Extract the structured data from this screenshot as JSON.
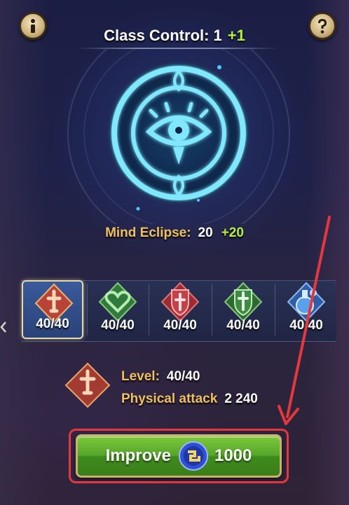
{
  "header": {
    "title_text": "Class Control: 1",
    "title_plus": "+1"
  },
  "buttons": {
    "info_icon": "info-icon",
    "help_icon": "question-icon"
  },
  "emblem": {
    "icon": "eye-icon",
    "color": "#7fe8ff"
  },
  "stat": {
    "label": "Mind Eclipse:",
    "value": "20",
    "plus": "+20"
  },
  "skills": [
    {
      "icon": "sword-diamond-icon",
      "count": "40/40",
      "selected": true
    },
    {
      "icon": "heart-diamond-icon",
      "count": "40/40",
      "selected": false
    },
    {
      "icon": "shield-sword-diamond-icon",
      "count": "40/40",
      "selected": false
    },
    {
      "icon": "shield-sword-green-icon",
      "count": "40/40",
      "selected": false
    },
    {
      "icon": "potion-diamond-icon",
      "count": "40/40",
      "selected": false
    }
  ],
  "detail": {
    "level_label": "Level:",
    "level_value": "40/40",
    "attack_label": "Physical attack",
    "attack_value": "2 240"
  },
  "improve": {
    "label": "Improve",
    "cost": "1000",
    "currency_icon": "coin-icon",
    "color": "#55a62a",
    "highlight_color": "#e5383d"
  }
}
